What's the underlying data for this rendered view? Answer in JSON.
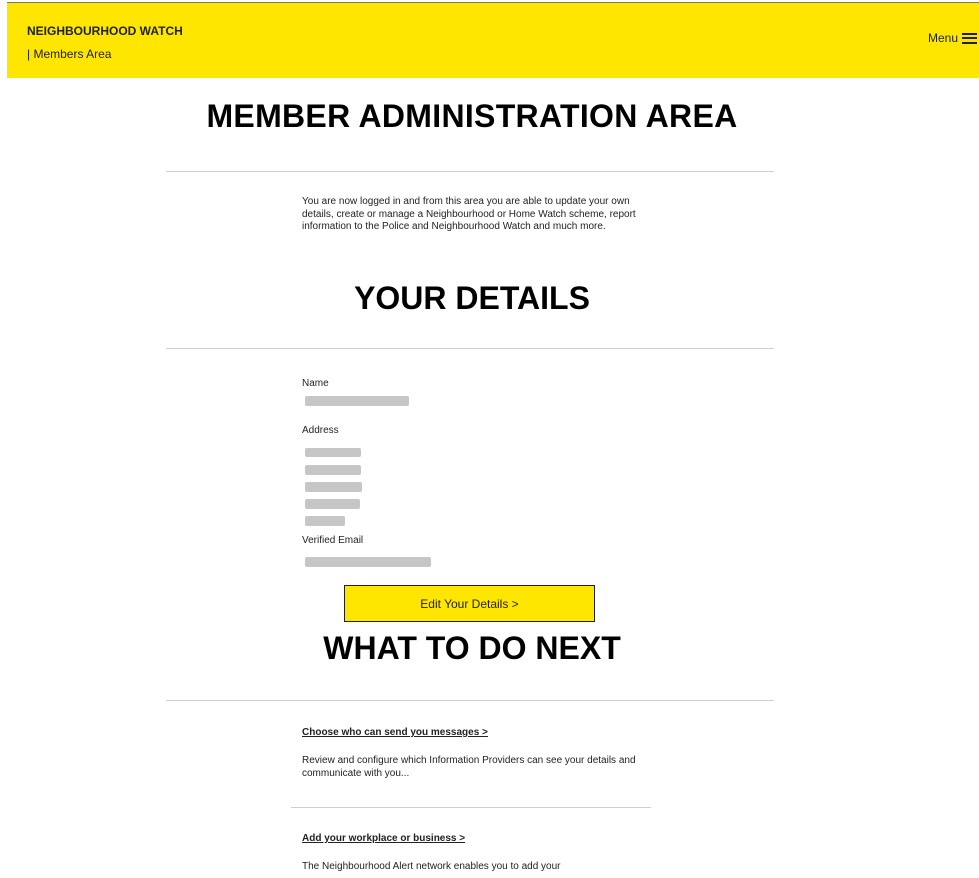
{
  "header": {
    "brand": "NEIGHBOURHOOD WATCH",
    "subtitle": "| Members Area",
    "menu_label": "Menu",
    "menu_icon": "hamburger-icon",
    "accent_color": "#ffe600"
  },
  "page": {
    "title": "MEMBER ADMINISTRATION AREA",
    "intro": "You are now logged in and from this area you are able to update your own details, create or manage a Neighbourhood or Home Watch scheme, report information to the Police and Neighbourhood Watch and much more."
  },
  "details": {
    "heading": "YOUR DETAILS",
    "name_label": "Name",
    "address_label": "Address",
    "email_label": "Verified Email",
    "edit_button": "Edit Your Details >"
  },
  "next": {
    "heading": "WHAT TO DO NEXT",
    "items": [
      {
        "link": "Choose who can send you messages >",
        "description": "Review and configure which Information Providers can see your details and communicate with you..."
      },
      {
        "link": "Add your workplace or business >",
        "description": "The Neighbourhood Alert network enables you to add your"
      }
    ]
  }
}
